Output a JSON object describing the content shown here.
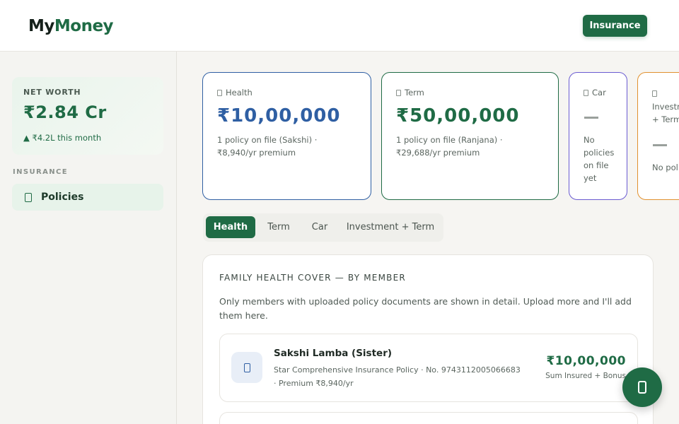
{
  "brand": {
    "part1": "My",
    "part2": "Money"
  },
  "header": {
    "insurance_button": "Insurance"
  },
  "sidebar": {
    "net_worth_label": "NET WORTH",
    "net_worth_value": "₹2.84 Cr",
    "net_worth_delta": "▲ ₹4.2L this month",
    "section_label": "INSURANCE",
    "nav_item": {
      "label": "Policies",
      "icon": "document-icon"
    }
  },
  "cards": [
    {
      "key": "health",
      "label": "Health",
      "amount": "₹10,00,000",
      "sub": "1 policy on file (Sakshi) · ₹8,940/yr premium",
      "color": "#2f5fa3"
    },
    {
      "key": "term",
      "label": "Term",
      "amount": "₹50,00,000",
      "sub": "1 policy on file (Ranjana) · ₹29,688/yr premium",
      "color": "#1f6b45"
    },
    {
      "key": "car",
      "label": "Car",
      "amount": "—",
      "sub": "No policies on file yet",
      "color": "#6a5bd1"
    },
    {
      "key": "investment",
      "label": "Investment + Term",
      "amount": "—",
      "sub": "No policies on file yet",
      "color": "#e1912f"
    }
  ],
  "tabs": [
    "Health",
    "Term",
    "Car",
    "Investment + Term"
  ],
  "active_tab": "Health",
  "panel": {
    "title": "FAMILY HEALTH COVER — BY MEMBER",
    "description": "Only members with uploaded policy documents are shown in detail. Upload more and I'll add them here."
  },
  "members": [
    {
      "name": "Sakshi Lamba (Sister)",
      "detail": "Star Comprehensive Insurance Policy · No. 9743112005066683 · Premium ₹8,940/yr",
      "amount": "₹10,00,000",
      "caption": "Sum Insured + Bonus",
      "icon": "shield-icon"
    }
  ],
  "fab": {
    "icon": "document-icon"
  },
  "colors": {
    "accent": "#1f6b45",
    "health": "#2f5fa3",
    "car": "#6a5bd1",
    "investment": "#e1912f"
  }
}
